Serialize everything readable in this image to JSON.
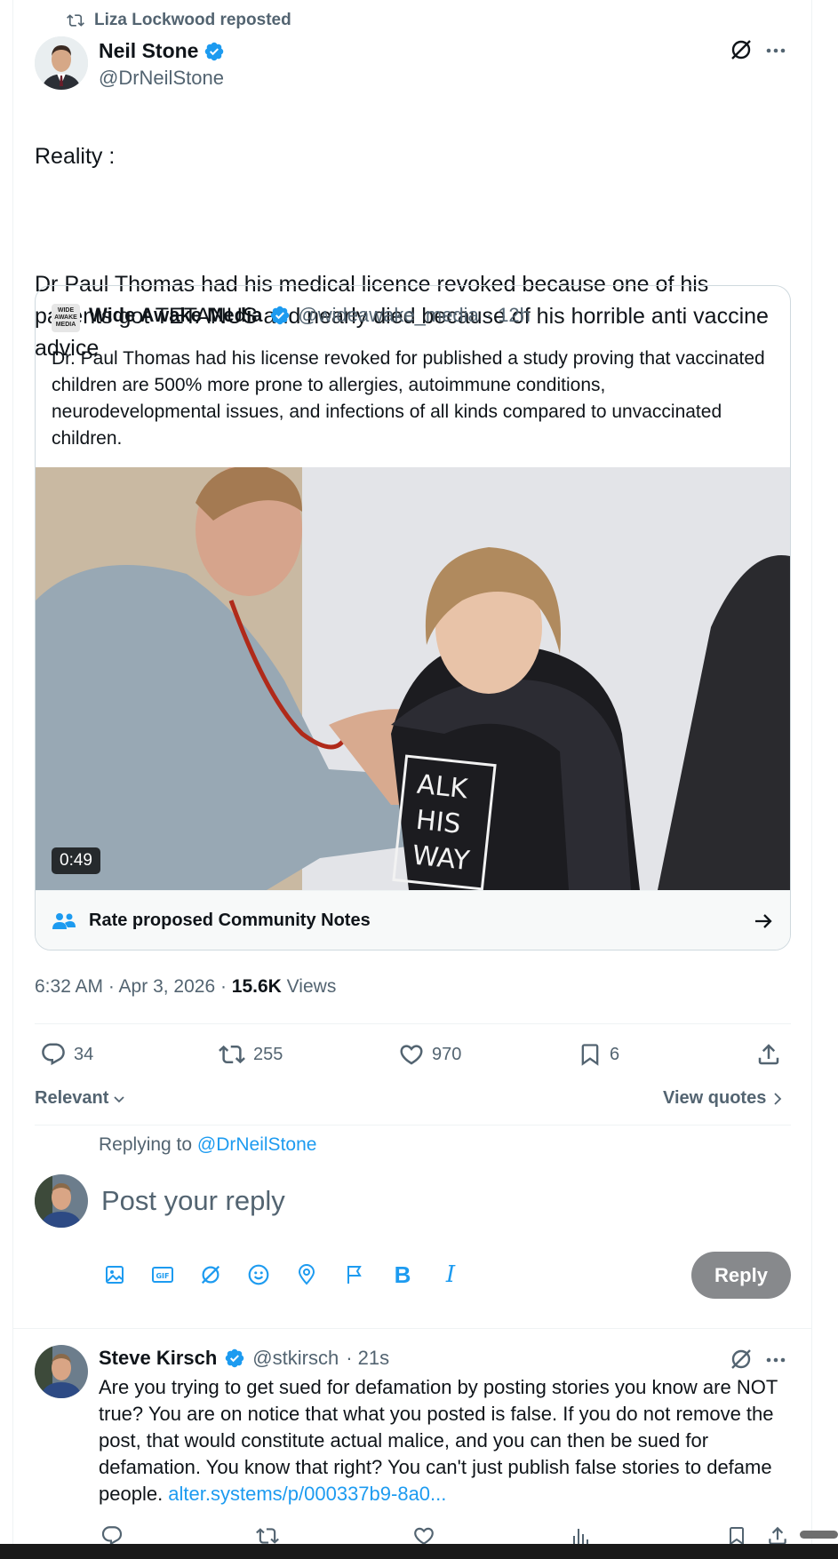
{
  "repost": {
    "text": "Liza Lockwood reposted"
  },
  "author": {
    "name": "Neil Stone",
    "handle": "@DrNeilStone"
  },
  "post": {
    "text_line1": "Reality :",
    "text_body": "Dr Paul Thomas had his medical licence revoked because one of his patients got TETANUS and nearly died because of his horrible anti vaccine advice"
  },
  "quote": {
    "avatar_text": "WIDE AWAKE MEDIA",
    "name": "Wide Awake Media",
    "handle": "@wideawake_media",
    "time": "· 12h",
    "text": "Dr. Paul Thomas had his license revoked for published a study proving that vaccinated children are 500% more prone to allergies, autoimmune conditions, neurodevelopmental issues, and infections of all kinds compared to unvaccinated children.",
    "video_duration": "0:49",
    "shirt_text": [
      "ALK",
      "HIS",
      "WAY"
    ],
    "community_notes_label": "Rate proposed Community Notes"
  },
  "meta": {
    "time_date": "6:32 AM · Apr 3, 2026 · ",
    "views_count": "15.6K",
    "views_label": " Views"
  },
  "stats": {
    "replies": "34",
    "reposts": "255",
    "likes": "970",
    "bookmarks": "6"
  },
  "sort": {
    "label": "Relevant",
    "view_quotes": "View quotes"
  },
  "composer": {
    "replying_to_prefix": "Replying to ",
    "replying_to_handle": "@DrNeilStone",
    "placeholder": "Post your reply",
    "reply_button": "Reply",
    "bold_label": "B",
    "italic_label": "I",
    "gif_label": "GIF"
  },
  "reply": {
    "name": "Steve Kirsch",
    "handle": "@stkirsch",
    "time": "· 21s",
    "text": "Are you trying to get sued for defamation by posting stories you know are NOT true? You are on notice that what you posted is false. If you do not remove the post, that would constitute actual malice, and you can then be sued for defamation. You know that right? You can't just publish false stories to defame people. ",
    "link": "alter.systems/p/000337b9-8a0..."
  },
  "colors": {
    "accent": "#1d9bf0",
    "text": "#0f1419",
    "secondary": "#536471",
    "border": "#eff3f4",
    "reply_button": "#87898c"
  }
}
